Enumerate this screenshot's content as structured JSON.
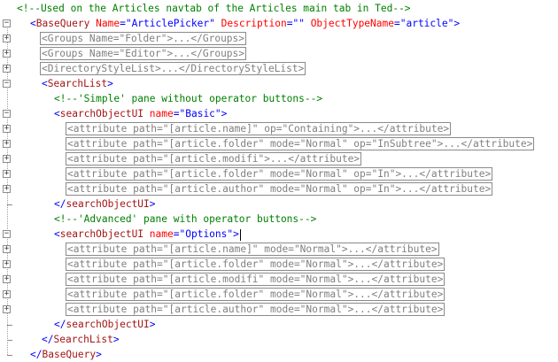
{
  "fold_markers": [
    "−",
    "+",
    "+",
    "+",
    "−",
    "−",
    "+",
    "+",
    "+",
    "+",
    "+",
    "−",
    "+",
    "+",
    "+",
    "+",
    "+"
  ],
  "lines": [
    [
      {
        "k": "c",
        "t": "<!--Used on the Articles navtab of the Articles main tab in Ted-->"
      }
    ],
    [
      {
        "k": "b",
        "t": "<"
      },
      {
        "k": "t",
        "t": "BaseQuery"
      },
      {
        "k": "t",
        "t": " "
      },
      {
        "k": "an",
        "t": "Name"
      },
      {
        "k": "b",
        "t": "=\""
      },
      {
        "k": "av",
        "t": "ArticlePicker"
      },
      {
        "k": "b",
        "t": "\""
      },
      {
        "k": "t",
        "t": " "
      },
      {
        "k": "an",
        "t": "Description"
      },
      {
        "k": "b",
        "t": "=\"\""
      },
      {
        "k": "t",
        "t": " "
      },
      {
        "k": "an",
        "t": "ObjectTypeName"
      },
      {
        "k": "b",
        "t": "=\""
      },
      {
        "k": "av",
        "t": "article"
      },
      {
        "k": "b",
        "t": "\">"
      }
    ],
    [
      {
        "k": "collapsed",
        "t": "<Groups Name=\"Folder\">...</Groups>"
      }
    ],
    [
      {
        "k": "collapsed",
        "t": "<Groups Name=\"Editor\">...</Groups>"
      }
    ],
    [
      {
        "k": "collapsed",
        "t": "<DirectoryStyleList>...</DirectoryStyleList>"
      }
    ],
    [
      {
        "k": "b",
        "t": "<"
      },
      {
        "k": "t",
        "t": "SearchList"
      },
      {
        "k": "b",
        "t": ">"
      }
    ],
    [
      {
        "k": "c",
        "t": "<!--'Simple' pane without operator buttons-->"
      }
    ],
    [
      {
        "k": "b",
        "t": "<"
      },
      {
        "k": "t",
        "t": "searchObjectUI"
      },
      {
        "k": "t",
        "t": " "
      },
      {
        "k": "an",
        "t": "name"
      },
      {
        "k": "b",
        "t": "=\""
      },
      {
        "k": "av",
        "t": "Basic"
      },
      {
        "k": "b",
        "t": "\">"
      }
    ],
    [
      {
        "k": "collapsed",
        "t": "<attribute path=\"[article.name]\" op=\"Containing\">...</attribute>"
      }
    ],
    [
      {
        "k": "collapsed",
        "t": "<attribute path=\"[article.folder\" mode=\"Normal\" op=\"InSubtree\">...</attribute>"
      }
    ],
    [
      {
        "k": "collapsed",
        "t": "<attribute path=\"[article.modifi\">...</attribute>"
      }
    ],
    [
      {
        "k": "collapsed",
        "t": "<attribute path=\"[article.folder\" mode=\"Normal\" op=\"In\">...</attribute>"
      }
    ],
    [
      {
        "k": "collapsed",
        "t": "<attribute path=\"[article.author\" mode=\"Normal\" op=\"In\">...</attribute>"
      }
    ],
    [
      {
        "k": "b",
        "t": "</"
      },
      {
        "k": "t",
        "t": "searchObjectUI"
      },
      {
        "k": "b",
        "t": ">"
      }
    ],
    [
      {
        "k": "c",
        "t": "<!--'Advanced' pane with operator buttons-->"
      }
    ],
    [
      {
        "k": "b",
        "t": "<"
      },
      {
        "k": "t",
        "t": "searchObjectUI"
      },
      {
        "k": "t",
        "t": " "
      },
      {
        "k": "an",
        "t": "name"
      },
      {
        "k": "b",
        "t": "=\""
      },
      {
        "k": "av",
        "t": "Options"
      },
      {
        "k": "b",
        "t": "\">"
      },
      {
        "k": "cursor",
        "t": ""
      }
    ],
    [
      {
        "k": "collapsed",
        "t": "<attribute path=\"[article.name]\" mode=\"Normal\">...</attribute>"
      }
    ],
    [
      {
        "k": "collapsed",
        "t": "<attribute path=\"[article.folder\" mode=\"Normal\">...</attribute>"
      }
    ],
    [
      {
        "k": "collapsed",
        "t": "<attribute path=\"[article.modifi\" mode=\"Normal\">...</attribute>"
      }
    ],
    [
      {
        "k": "collapsed",
        "t": "<attribute path=\"[article.folder\" mode=\"Normal\">...</attribute>"
      }
    ],
    [
      {
        "k": "collapsed",
        "t": "<attribute path=\"[article.author\" mode=\"Normal\">...</attribute>"
      }
    ],
    [
      {
        "k": "b",
        "t": "</"
      },
      {
        "k": "t",
        "t": "searchObjectUI"
      },
      {
        "k": "b",
        "t": ">"
      }
    ],
    [
      {
        "k": "b",
        "t": "</"
      },
      {
        "k": "t",
        "t": "SearchList"
      },
      {
        "k": "b",
        "t": ">"
      }
    ],
    [
      {
        "k": "b",
        "t": "</"
      },
      {
        "k": "t",
        "t": "BaseQuery"
      },
      {
        "k": "b",
        "t": ">"
      }
    ]
  ]
}
